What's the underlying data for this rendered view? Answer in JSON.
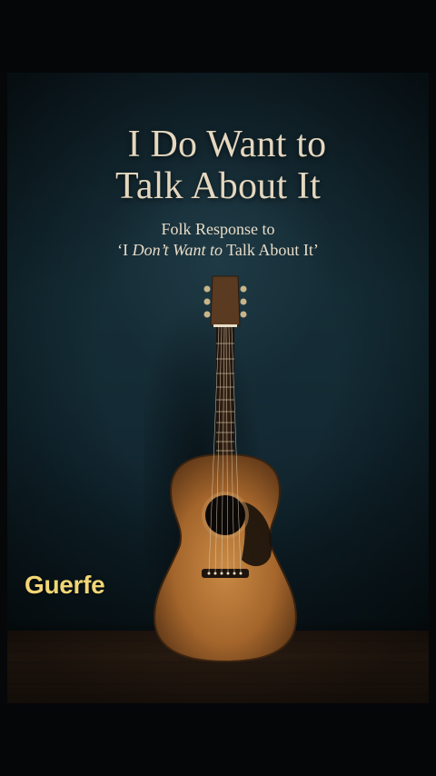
{
  "poster": {
    "title_line1": "I Do Want to",
    "title_line2": "Talk About It",
    "subtitle_line1": "Folk Response to",
    "subtitle_line2_pre": "‘I ",
    "subtitle_line2_italic": "Don’t Want to",
    "subtitle_line2_post": " Talk About It’",
    "brand": "Guerfe"
  },
  "colors": {
    "title": "#e4d7bf",
    "brand": "#f2d676",
    "background": "#143039",
    "floor": "#3b2819"
  },
  "icons": {
    "guitar": "acoustic-guitar-icon"
  }
}
